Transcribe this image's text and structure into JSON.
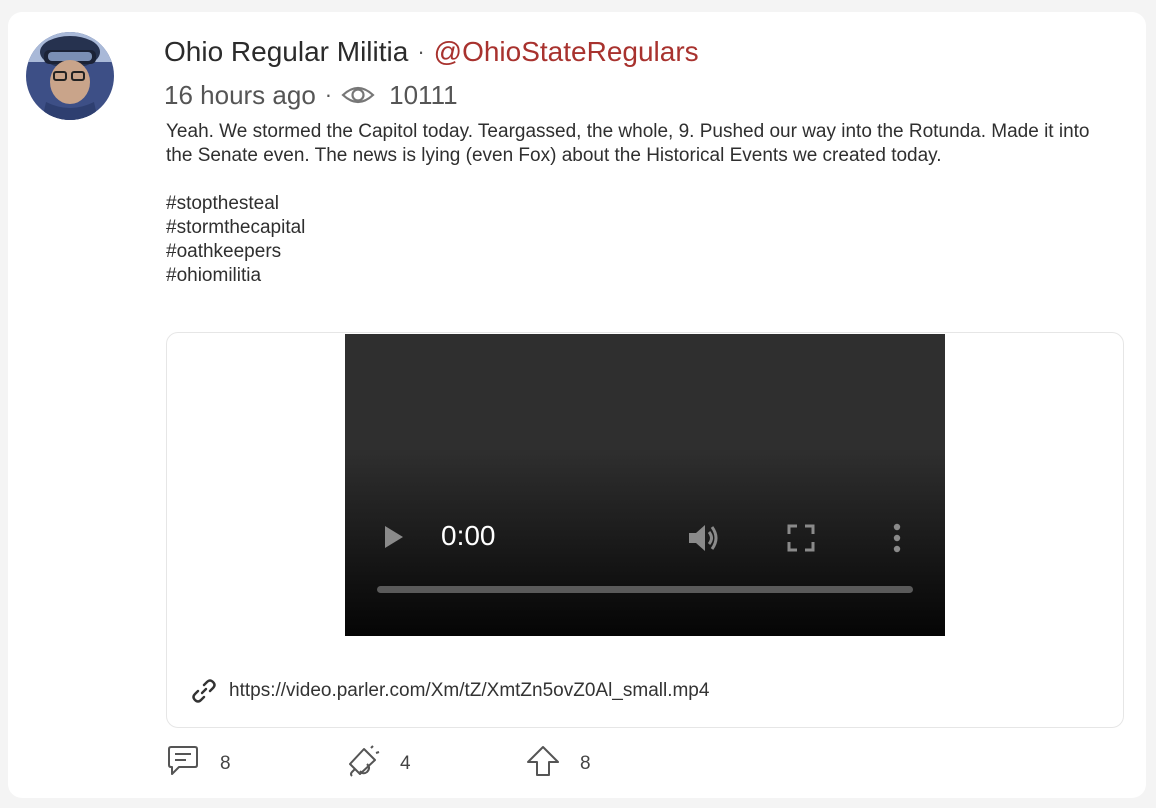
{
  "post": {
    "author_name": "Ohio Regular Militia",
    "separator": "·",
    "author_handle": "@OhioStateRegulars",
    "timestamp": "16 hours ago",
    "view_count": "10111",
    "body_paragraph": "Yeah. We stormed the Capitol today. Teargassed, the whole, 9. Pushed our way into the Rotunda. Made it into the Senate even. The news is lying (even Fox) about the Historical Events we created today.",
    "hashtags": [
      "#stopthesteal",
      "#stormthecapital",
      "#oathkeepers",
      "#ohiomilitia"
    ]
  },
  "media": {
    "video_time": "0:00",
    "video_progress": 0,
    "link_url": "https://video.parler.com/Xm/tZ/XmtZn5ovZ0Al_small.mp4"
  },
  "actions": {
    "comments": "8",
    "echoes": "4",
    "upvotes": "8"
  },
  "icons": {
    "views": "eye-icon",
    "link": "link-icon",
    "comment": "comment-icon",
    "echo": "megaphone-icon",
    "upvote": "upvote-arrow-icon",
    "play": "play-icon",
    "volume": "volume-icon",
    "fullscreen": "fullscreen-icon",
    "more": "more-vertical-icon"
  },
  "colors": {
    "handle": "#a8322e",
    "card_background": "#ffffff",
    "page_background": "#f4f4f4"
  }
}
